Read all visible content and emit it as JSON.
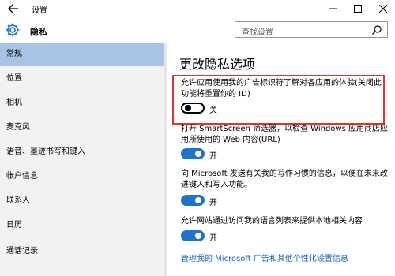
{
  "window": {
    "title": "设置"
  },
  "header": {
    "section": "隐私",
    "search_placeholder": "查找设置"
  },
  "sidebar": {
    "items": [
      {
        "label": "常规",
        "active": true
      },
      {
        "label": "位置"
      },
      {
        "label": "相机"
      },
      {
        "label": "麦克风"
      },
      {
        "label": "语音、墨迹书写和键入"
      },
      {
        "label": "帐户信息"
      },
      {
        "label": "联系人"
      },
      {
        "label": "日历"
      },
      {
        "label": "通话记录"
      }
    ]
  },
  "main": {
    "title": "更改隐私选项",
    "options": [
      {
        "text": "允许应用使用我的广告标识符了解对各应用的体验(关闭此功能将重置你的 ID)",
        "state": "关",
        "on": false
      },
      {
        "text": "打开 SmartScreen 筛选器，以检查 Windows 应用商店应用所使用的 Web 内容(URL)",
        "state": "开",
        "on": true
      },
      {
        "text": "向 Microsoft 发送有关我的写作习惯的信息，以便在未来改进键入和写入功能。",
        "state": "开",
        "on": true
      },
      {
        "text": "允许网站通过访问我的语言列表来提供本地相关内容",
        "state": "开",
        "on": true
      }
    ],
    "link": "管理我的 Microsoft 广告和其他个性化设置信息"
  },
  "colors": {
    "accent": "#1f73c8",
    "selected": "#a9c3e4",
    "highlight_border": "#e0352b",
    "link": "#1e5eb8"
  }
}
